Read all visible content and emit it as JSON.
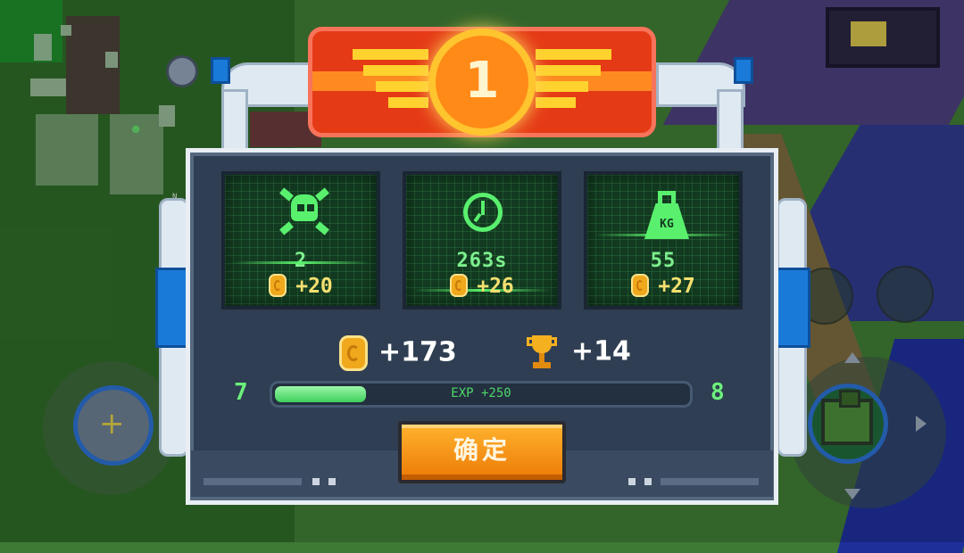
{
  "result": {
    "rank": "1",
    "stats": [
      {
        "icon": "skull-icon",
        "value": "2",
        "reward": "+20"
      },
      {
        "icon": "clock-icon",
        "value": "263s",
        "reward": "+26"
      },
      {
        "icon": "weight-icon",
        "icon_label": "KG",
        "value": "55",
        "reward": "+27"
      }
    ],
    "total_coins": "+173",
    "total_trophies": "+14",
    "level_current": "7",
    "level_next": "8",
    "exp_label": "EXP +250",
    "exp_progress": 0.22,
    "confirm_label": "确定"
  },
  "minimap": {
    "north_label": "N"
  },
  "colors": {
    "accent_green": "#59f06e",
    "coin": "#f0a81c",
    "button": "#f08a10",
    "banner": "#e53a16"
  }
}
